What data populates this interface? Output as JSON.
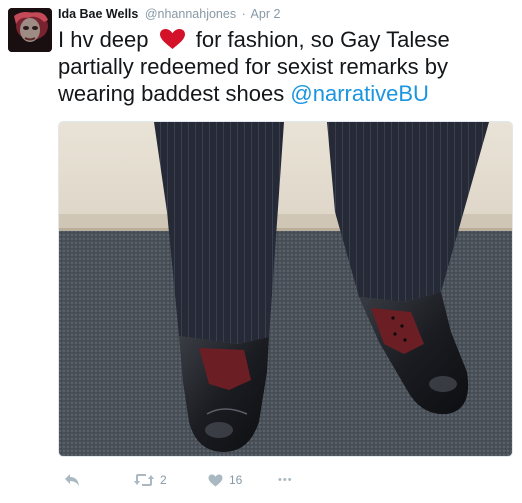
{
  "tweet": {
    "author_name": "Ida Bae Wells",
    "handle": "@nhannahjones",
    "separator": "·",
    "date": "Apr 2",
    "text_before_heart": "I hv deep",
    "text_after_heart": "for fashion, so Gay Talese partially redeemed for sexist remarks by wearing baddest shoes",
    "mention": "@narrativeBU"
  },
  "actions": {
    "retweet_count": "2",
    "like_count": "16",
    "more_label": "•••"
  },
  "colors": {
    "mention": "#1b95e0",
    "heart_emoji": "#d3122a",
    "action_icons": "#aab8c2"
  },
  "icons": {
    "reply": "reply-icon",
    "retweet": "retweet-icon",
    "like": "heart-icon",
    "more": "more-icon"
  }
}
